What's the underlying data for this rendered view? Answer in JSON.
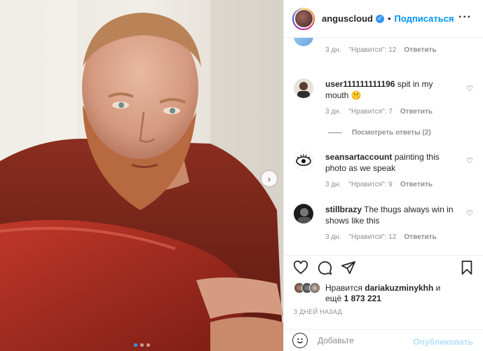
{
  "header": {
    "username": "anguscloud",
    "separator": "•",
    "follow_label": "Подписаться",
    "more_label": "···"
  },
  "comments": [
    {
      "username": "",
      "text": "",
      "age": "3 дн.",
      "likes": "\"Нравится\": 12",
      "reply": "Ответить"
    },
    {
      "username": "user111111111196",
      "text": "spit in my mouth 🤫",
      "age": "3 дн.",
      "likes": "\"Нравится\": 7",
      "reply": "Ответить"
    },
    {
      "username": "seansartaccount",
      "text": "painting this photo as we speak",
      "age": "3 дн.",
      "likes": "\"Нравится\": 9",
      "reply": "Ответить"
    },
    {
      "username": "stillbrazy",
      "text": "The thugs always win in shows like this",
      "age": "3 дн.",
      "likes": "\"Нравится\": 12",
      "reply": "Ответить"
    }
  ],
  "view_replies": "Посмотреть ответы (2)",
  "likes": {
    "prefix": "Нравится",
    "user": "dariakuzminykhh",
    "conj": "и",
    "more_prefix": "ещё",
    "count": "1 873 221"
  },
  "timestamp": "3 ДНЕЙ НАЗАД",
  "add_comment": {
    "placeholder": "Добавьте",
    "post_label": "Опубликовать"
  },
  "carousel": {
    "slides": 3,
    "active_index": 0
  },
  "colors": {
    "accent": "#0095f6",
    "verified": "#3897f0",
    "muted": "#8e8e8e"
  }
}
